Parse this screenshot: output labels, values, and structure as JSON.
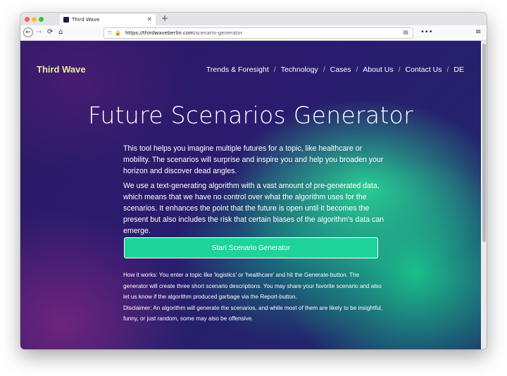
{
  "browser": {
    "tab_title": "Third Wave",
    "tab_close": "✕",
    "new_tab": "+",
    "url_domain": "https://thirdwaveberlin.com",
    "url_path": "/scenario-generator"
  },
  "site": {
    "logo": "Third Wave",
    "nav": [
      "Trends & Foresight",
      "Technology",
      "Cases",
      "About Us",
      "Contact Us",
      "DE"
    ],
    "nav_separator": "/"
  },
  "main": {
    "title": "Future Scenarios Generator",
    "intro_1": "This tool helps you imagine multiple futures for a topic, like healthcare or mobility. The scenarios will surprise and inspire you and help you broaden your horizon and discover dead angles.",
    "intro_2": "We use a text-generating algorithm with a vast amount of pre-generated data, which means that we have no control over what the algorithm uses for the scenarios. It enhances the point that the future is open until it becomes the present but also includes the risk that certain biases of the algorithm's data can emerge.",
    "cta_label": "Start Scenario Generator",
    "how_it_works": "How it works: You enter a topic like 'logistics' or 'healthcare' and hit the Generate-button. The generator will create three short scenario descriptions. You may share your favorite scenario and also let us know if the algorithm produced garbage via the Report-button.",
    "disclaimer": "Disclaimer: An algorithm will generate the scenarios, and while most of them are likely to be insightful, funny, or just random, some may also be offensive."
  },
  "icons": {
    "back": "←",
    "forward": "→",
    "reload": "⟳",
    "home": "⌂",
    "shield": "⛉",
    "lock": "🔒",
    "reader": "▤",
    "more": "•••",
    "menu": "≡"
  },
  "colors": {
    "logo": "#e8ee9c",
    "cta_bg": "#1ed39a",
    "page_dark": "#2a1b6e",
    "page_green": "#28d796"
  }
}
